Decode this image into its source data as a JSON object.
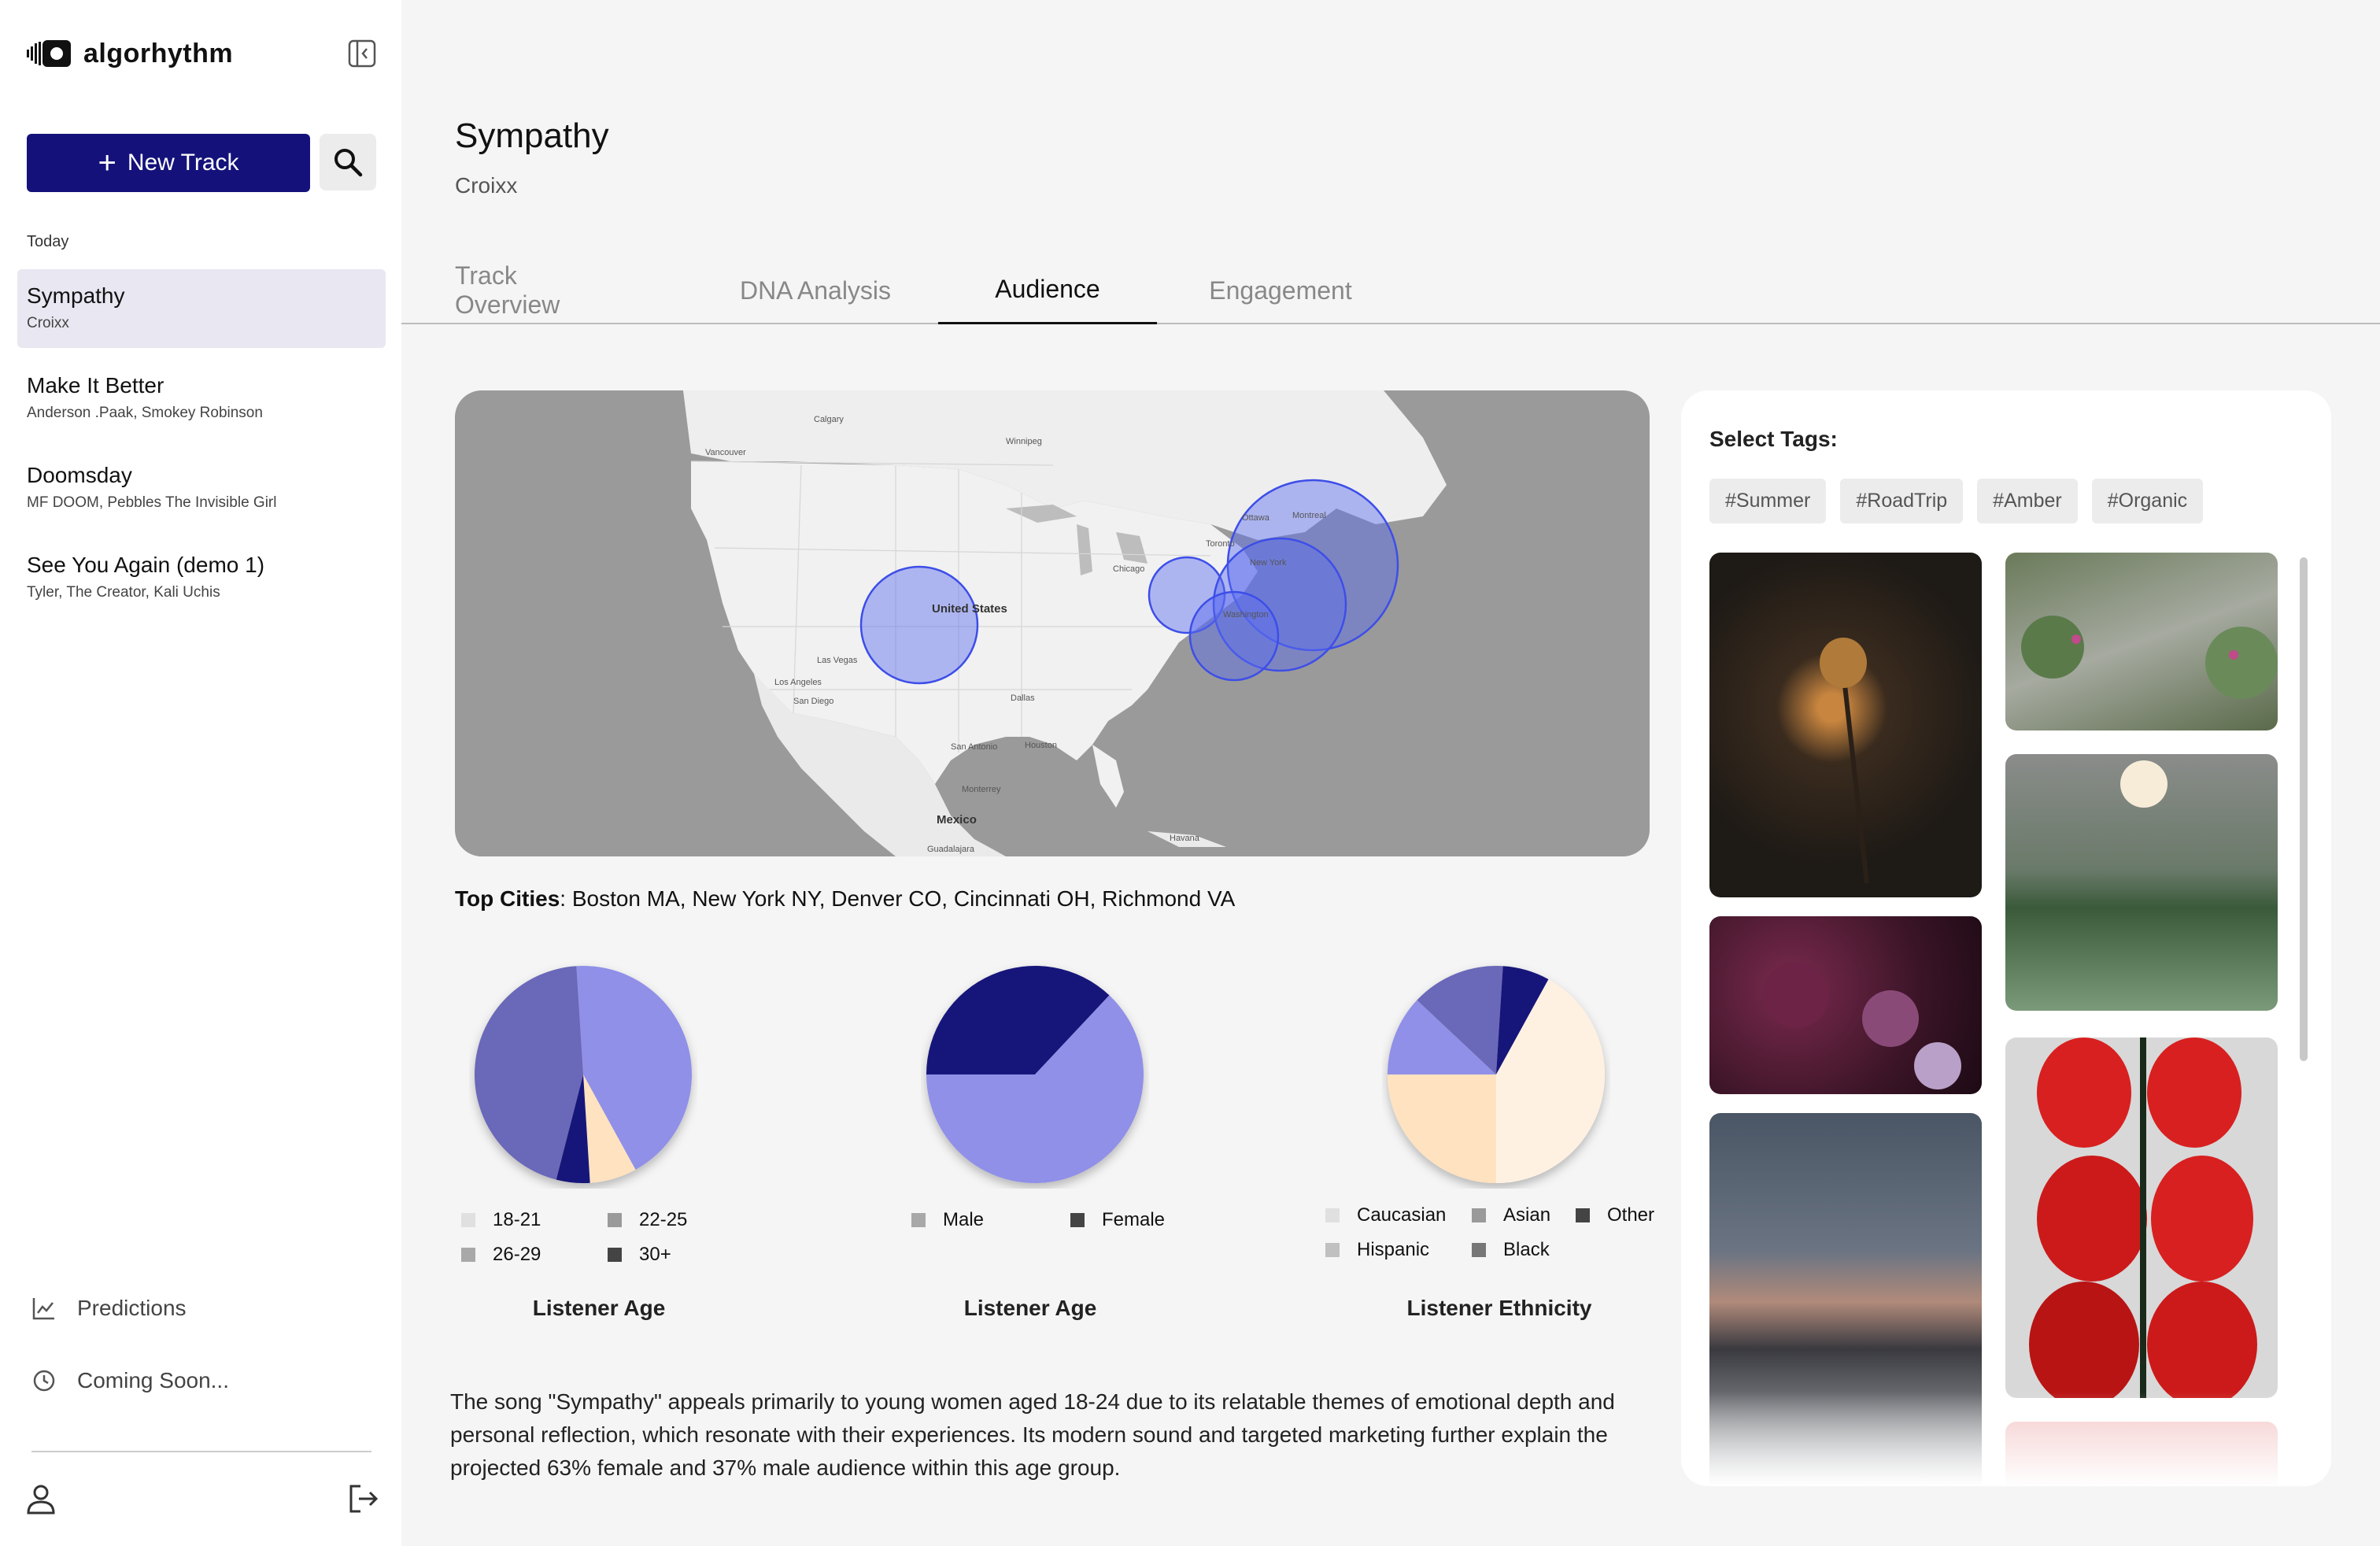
{
  "app": {
    "name": "algorhythm"
  },
  "sidebar": {
    "new_track_label": "New Track",
    "section_label": "Today",
    "tracks": [
      {
        "title": "Sympathy",
        "artist": "Croixx",
        "active": true
      },
      {
        "title": "Make It Better",
        "artist": "Anderson .Paak, Smokey Robinson"
      },
      {
        "title": "Doomsday",
        "artist": "MF DOOM, Pebbles The Invisible Girl"
      },
      {
        "title": "See You Again (demo 1)",
        "artist": "Tyler, The Creator, Kali Uchis"
      }
    ],
    "nav": [
      {
        "label": "Predictions",
        "icon": "chart-line-icon"
      },
      {
        "label": "Coming Soon...",
        "icon": "clock-icon"
      }
    ]
  },
  "header": {
    "title": "Sympathy",
    "artist": "Croixx"
  },
  "tabs": [
    {
      "label": "Track Overview"
    },
    {
      "label": "DNA Analysis"
    },
    {
      "label": "Audience",
      "active": true
    },
    {
      "label": "Engagement"
    }
  ],
  "map": {
    "labels": {
      "country_us": "United States",
      "country_mx": "Mexico",
      "calgary": "Calgary",
      "vancouver": "Vancouver",
      "winnipeg": "Winnipeg",
      "ottawa": "Ottawa",
      "montreal": "Montreal",
      "toronto": "Toronto",
      "chicago": "Chicago",
      "new_york": "New York",
      "washington": "Washington",
      "las_vegas": "Las Vegas",
      "los_angeles": "Los Angeles",
      "san_diego": "San Diego",
      "dallas": "Dallas",
      "san_antonio": "San Antonio",
      "houston": "Houston",
      "monterrey": "Monterrey",
      "guadalajara": "Guadalajara",
      "havana": "Havana"
    },
    "bubble_color": "#5b6cf0"
  },
  "audience": {
    "top_cities_label": "Top Cities",
    "top_cities": "Boston MA, New York NY, Denver CO, Cincinnati OH, Richmond VA"
  },
  "charts_meta": {
    "colors": {
      "light_purple": "#9090e8",
      "mid_purple": "#6a68b8",
      "navy": "#14127a",
      "peach": "#ffe2c0",
      "cream": "#fff1e2"
    }
  },
  "chart_data": [
    {
      "type": "pie",
      "title": "Listener Age",
      "categories": [
        "18-21",
        "22-25",
        "26-29",
        "30+"
      ],
      "values": [
        43,
        7,
        5,
        45
      ],
      "legend": [
        "18-21",
        "22-25",
        "26-29",
        "30+"
      ],
      "legend_colors": [
        "#e0e0e0",
        "#9a9a9a",
        "#a8a8a8",
        "#444444"
      ],
      "slice_colors": [
        "#9090e8",
        "#ffe2c0",
        "#14127a",
        "#6a68b8"
      ]
    },
    {
      "type": "pie",
      "title": "Listener Age",
      "categories": [
        "Male",
        "Female"
      ],
      "values": [
        37,
        63
      ],
      "legend": [
        "Male",
        "Female"
      ],
      "legend_colors": [
        "#a8a8a8",
        "#444444"
      ],
      "slice_colors": [
        "#14127a",
        "#9090e8"
      ]
    },
    {
      "type": "pie",
      "title": "Listener Ethnicity",
      "categories": [
        "Caucasian",
        "Asian",
        "Other",
        "Hispanic",
        "Black"
      ],
      "values": [
        12,
        14,
        7,
        42,
        25
      ],
      "legend": [
        "Caucasian",
        "Asian",
        "Other",
        "Hispanic",
        "Black"
      ],
      "legend_colors": [
        "#e0e0e0",
        "#9a9a9a",
        "#444444",
        "#c0c0c0",
        "#777777"
      ],
      "slice_colors": [
        "#9090e8",
        "#6a68b8",
        "#14127a",
        "#fff1e2",
        "#ffe2c0"
      ]
    }
  ],
  "summary": "The song \"Sympathy\" appeals primarily to young women aged 18-24 due to its relatable themes of emotional depth and personal reflection, which resonate with their experiences. Its modern sound and targeted marketing further explain the projected 63% female and 37% male audience within this age group.",
  "tags_panel": {
    "title": "Select Tags:",
    "tags": [
      "#Summer",
      "#RoadTrip",
      "#Amber",
      "#Organic"
    ]
  }
}
